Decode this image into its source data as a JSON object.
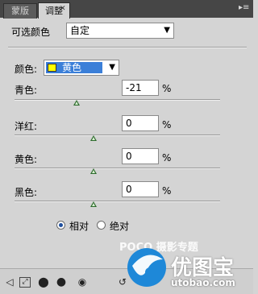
{
  "tabs": [
    {
      "label": "蒙版"
    },
    {
      "label": "调整"
    }
  ],
  "preset": {
    "label": "可选颜色",
    "value": "自定"
  },
  "colors": {
    "label": "颜色:",
    "value": "黄色",
    "swatch": "#ffff00",
    "highlight": "#3b7fd8"
  },
  "sliders": [
    {
      "label": "青色:",
      "value": "-21",
      "unit": "%"
    },
    {
      "label": "洋红:",
      "value": "0",
      "unit": "%"
    },
    {
      "label": "黄色:",
      "value": "0",
      "unit": "%"
    },
    {
      "label": "黑色:",
      "value": "0",
      "unit": "%"
    }
  ],
  "method": {
    "options": [
      "相对",
      "绝对"
    ],
    "selected": "相对"
  },
  "watermark": {
    "poco": "POCO 摄影专题",
    "brand": "优图宝",
    "url": "utobao.com"
  },
  "icons": [
    "back-arrow-icon",
    "expand-view-icon",
    "clip-layer-icon",
    "visibility-eye-icon",
    "reset-icon"
  ]
}
